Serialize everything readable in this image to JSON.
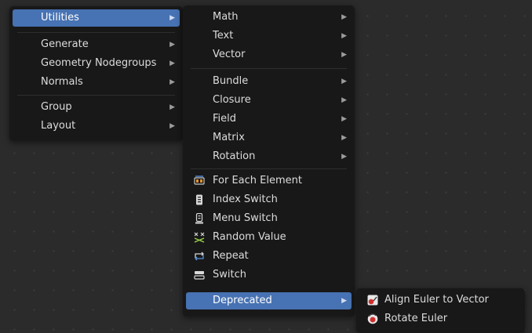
{
  "colors": {
    "highlight": "#4772b3",
    "menu_bg": "#181818",
    "canvas_bg": "#2b2b2b"
  },
  "menu1": {
    "items": [
      {
        "label": "Utilities",
        "submenu": true,
        "active": true
      },
      {
        "label": "Generate",
        "submenu": true
      },
      {
        "label": "Geometry Nodegroups",
        "submenu": true
      },
      {
        "label": "Normals",
        "submenu": true
      },
      {
        "label": "Group",
        "submenu": true
      },
      {
        "label": "Layout",
        "submenu": true
      }
    ]
  },
  "menu2": {
    "items": [
      {
        "label": "Math",
        "submenu": true
      },
      {
        "label": "Text",
        "submenu": true
      },
      {
        "label": "Vector",
        "submenu": true
      },
      {
        "label": "Bundle",
        "submenu": true
      },
      {
        "label": "Closure",
        "submenu": true
      },
      {
        "label": "Field",
        "submenu": true
      },
      {
        "label": "Matrix",
        "submenu": true
      },
      {
        "label": "Rotation",
        "submenu": true
      },
      {
        "label": "For Each Element",
        "icon": "for-each-element-icon"
      },
      {
        "label": "Index Switch",
        "icon": "index-switch-icon"
      },
      {
        "label": "Menu Switch",
        "icon": "menu-switch-icon"
      },
      {
        "label": "Random Value",
        "icon": "random-value-icon"
      },
      {
        "label": "Repeat",
        "icon": "repeat-icon"
      },
      {
        "label": "Switch",
        "icon": "switch-icon"
      },
      {
        "label": "Deprecated",
        "submenu": true,
        "active": true
      }
    ]
  },
  "menu3": {
    "items": [
      {
        "label": "Align Euler to Vector",
        "icon": "align-euler-icon"
      },
      {
        "label": "Rotate Euler",
        "icon": "rotate-euler-icon"
      }
    ]
  }
}
